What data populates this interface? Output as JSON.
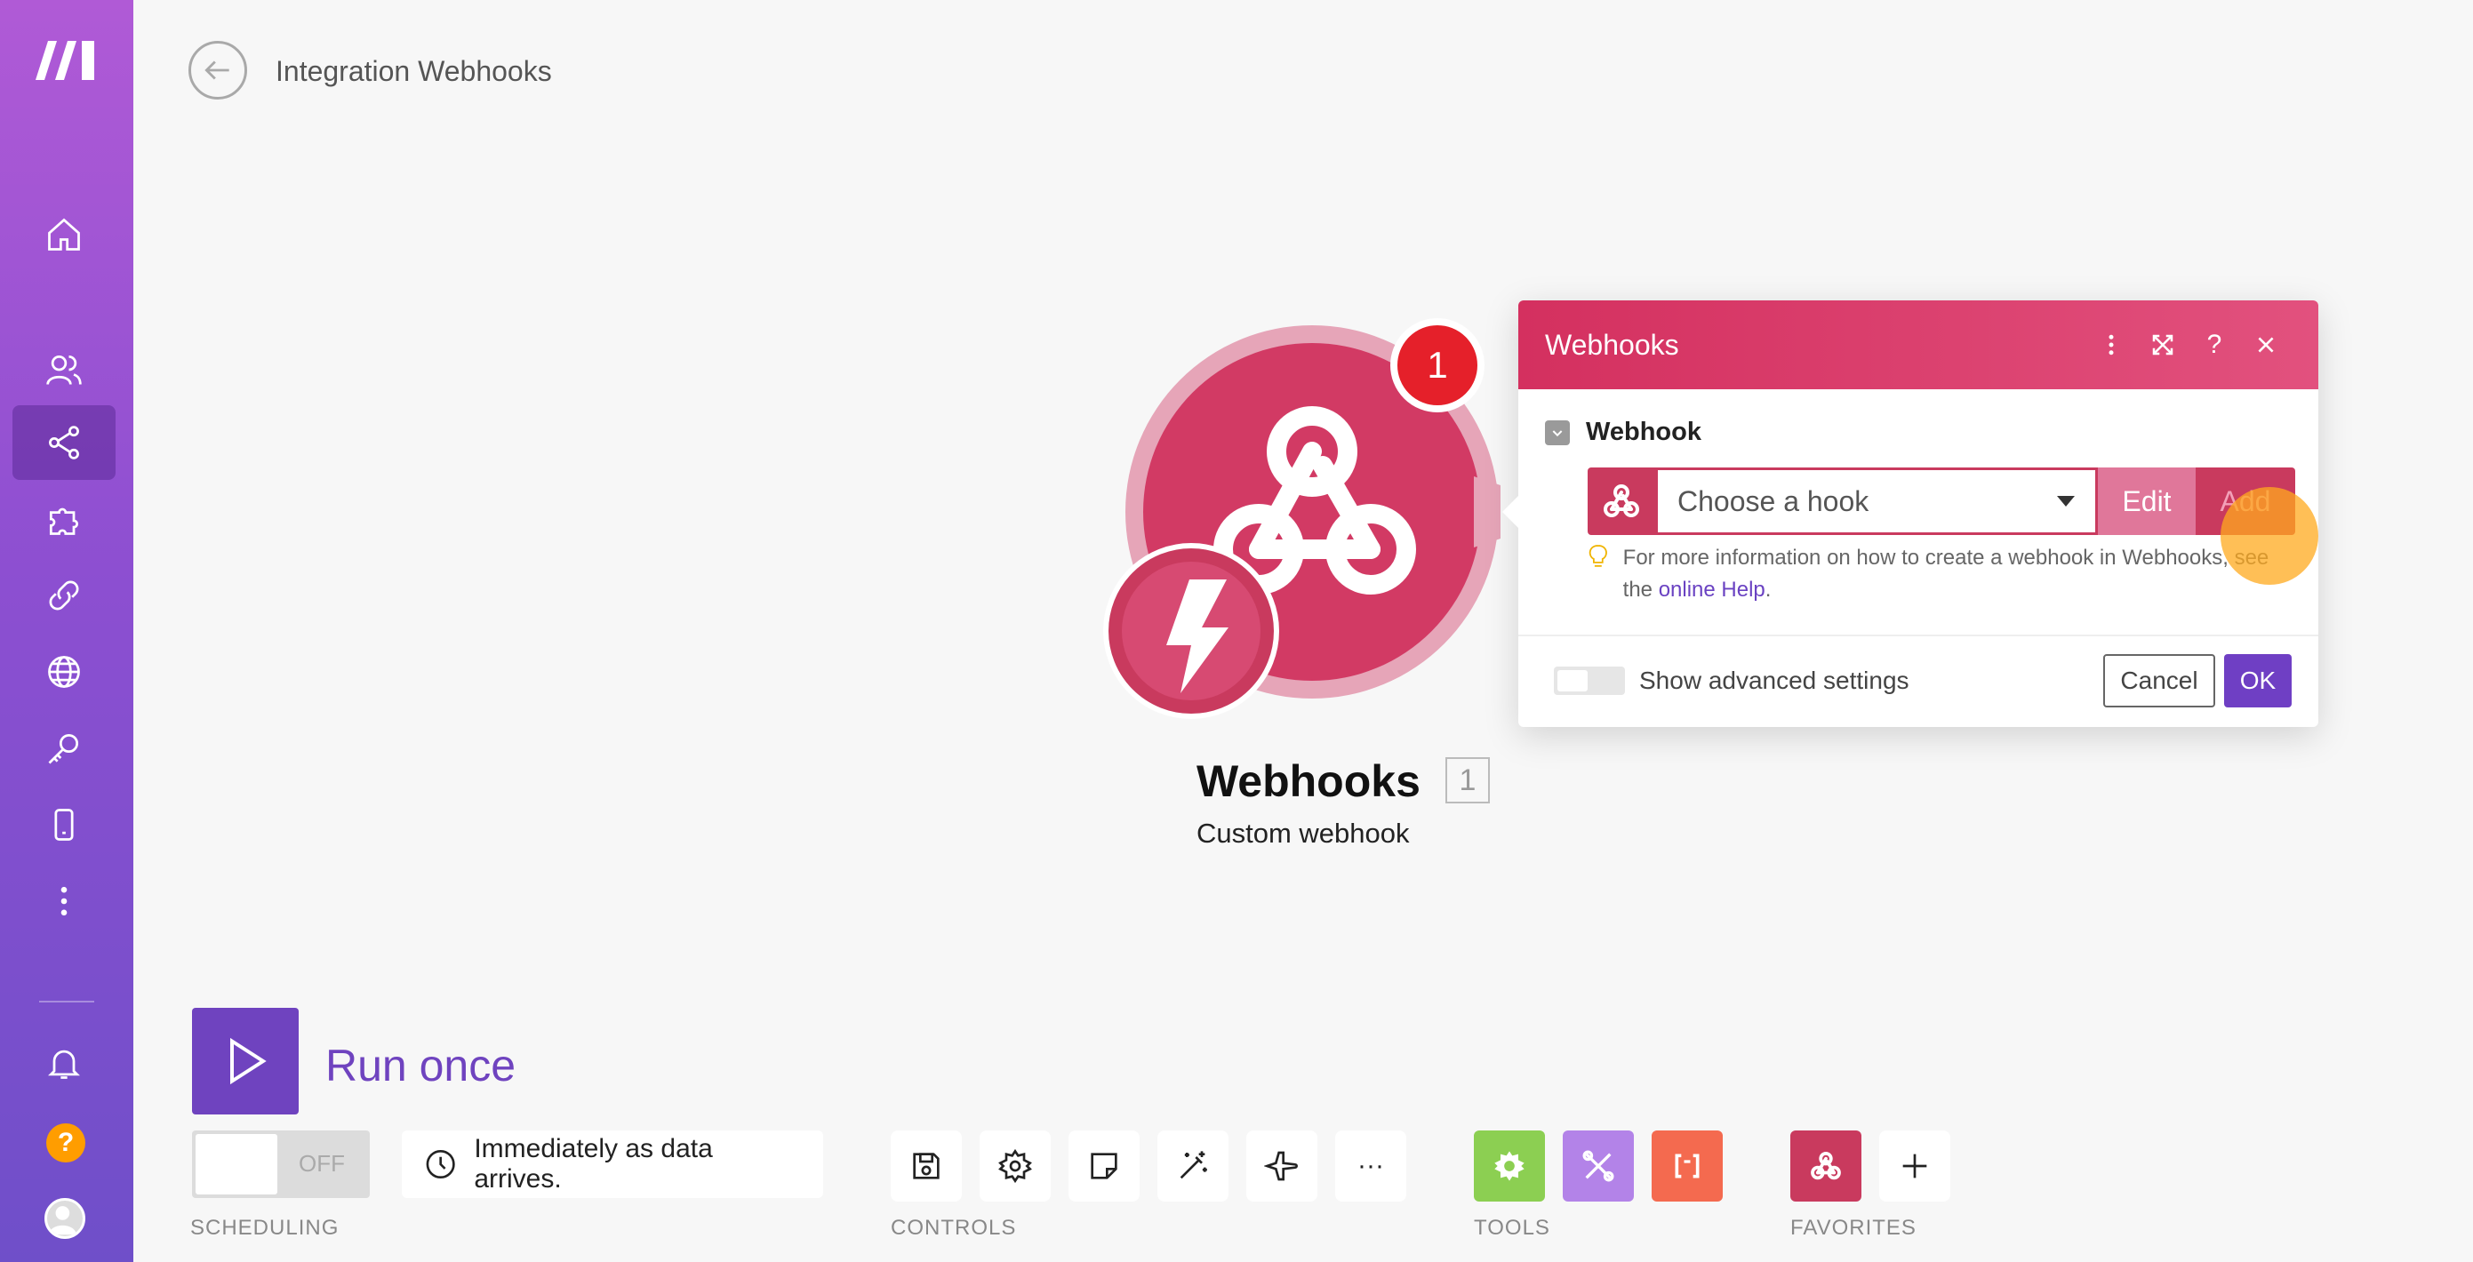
{
  "header": {
    "title": "Integration Webhooks"
  },
  "module": {
    "name": "Webhooks",
    "index": "1",
    "subtitle": "Custom webhook",
    "badge_count": "1"
  },
  "dialog": {
    "title": "Webhooks",
    "section_label": "Webhook",
    "select_placeholder": "Choose a hook",
    "edit_label": "Edit",
    "add_label": "Add",
    "hint_prefix": "For more information on how to create a webhook in Webhooks, see the ",
    "hint_link": "online Help",
    "hint_suffix": ".",
    "advanced_label": "Show advanced settings",
    "cancel_label": "Cancel",
    "ok_label": "OK"
  },
  "bottom": {
    "run_label": "Run once",
    "schedule_state": "OFF",
    "schedule_text": "Immediately as data arrives.",
    "groups": {
      "scheduling": "SCHEDULING",
      "controls": "CONTROLS",
      "tools": "TOOLS",
      "favorites": "FAVORITES"
    },
    "more_label": "···"
  },
  "colors": {
    "accent": "#6f43bf",
    "webhook": "#c93a5e",
    "badge": "#e5202a",
    "tools_green": "#8ccf52",
    "tools_purple": "#b383e8",
    "tools_orange": "#f46a4f"
  }
}
